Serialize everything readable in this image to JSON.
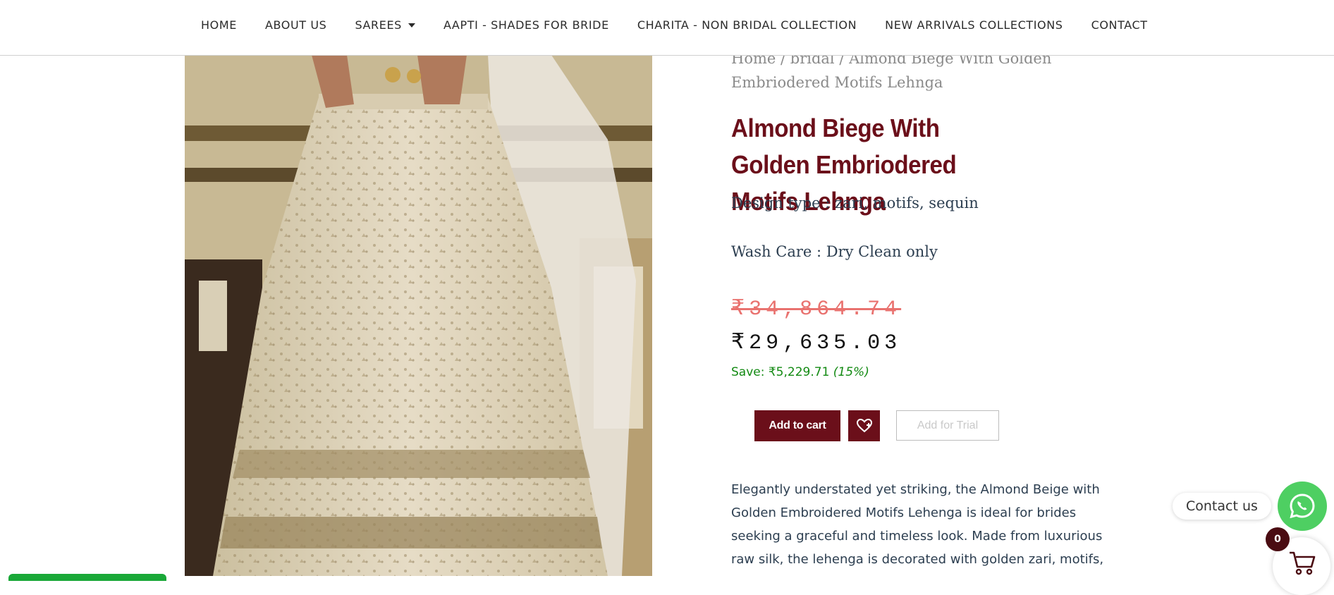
{
  "nav": {
    "items": [
      {
        "label": "HOME"
      },
      {
        "label": "ABOUT US"
      },
      {
        "label": "SAREES"
      },
      {
        "label": "AAPTI - SHADES FOR BRIDE"
      },
      {
        "label": "CHARITA - NON BRIDAL COLLECTION"
      },
      {
        "label": "NEW ARRIVALS COLLECTIONS"
      },
      {
        "label": "CONTACT"
      }
    ]
  },
  "breadcrumb": {
    "home": "Home",
    "sep": " / ",
    "category": "bridal",
    "current": "Almond Biege With Golden Embriodered Motifs Lehnga"
  },
  "product": {
    "title": "Almond Biege With Golden Embriodered Motifs Lehnga",
    "design_type": "Design type : zari, motifs, sequin",
    "wash_care": "Wash Care : Dry Clean only",
    "old_price": "₹34,864.74",
    "price": "₹29,635.03",
    "save_label": "Save: ₹5,229.71",
    "save_percent": "(15%)",
    "description": "Elegantly understated yet striking, the Almond Beige with Golden Embroidered Motifs Lehenga is ideal for brides seeking a graceful and timeless look. Made from luxurious raw silk, the lehenga is decorated with golden zari, motifs,"
  },
  "actions": {
    "add_to_cart": "Add to cart",
    "add_for_trial": "Add for Trial",
    "wishlist_icon": "heart-plus-icon"
  },
  "widgets": {
    "contact_label": "Contact us",
    "cart_count": "0",
    "whatsapp_icon": "whatsapp-icon",
    "cart_icon": "cart-icon"
  },
  "colors": {
    "brand": "#6b0f1a",
    "old_price": "#e9726f",
    "save": "#138a13",
    "whatsapp": "#4ecf62"
  }
}
